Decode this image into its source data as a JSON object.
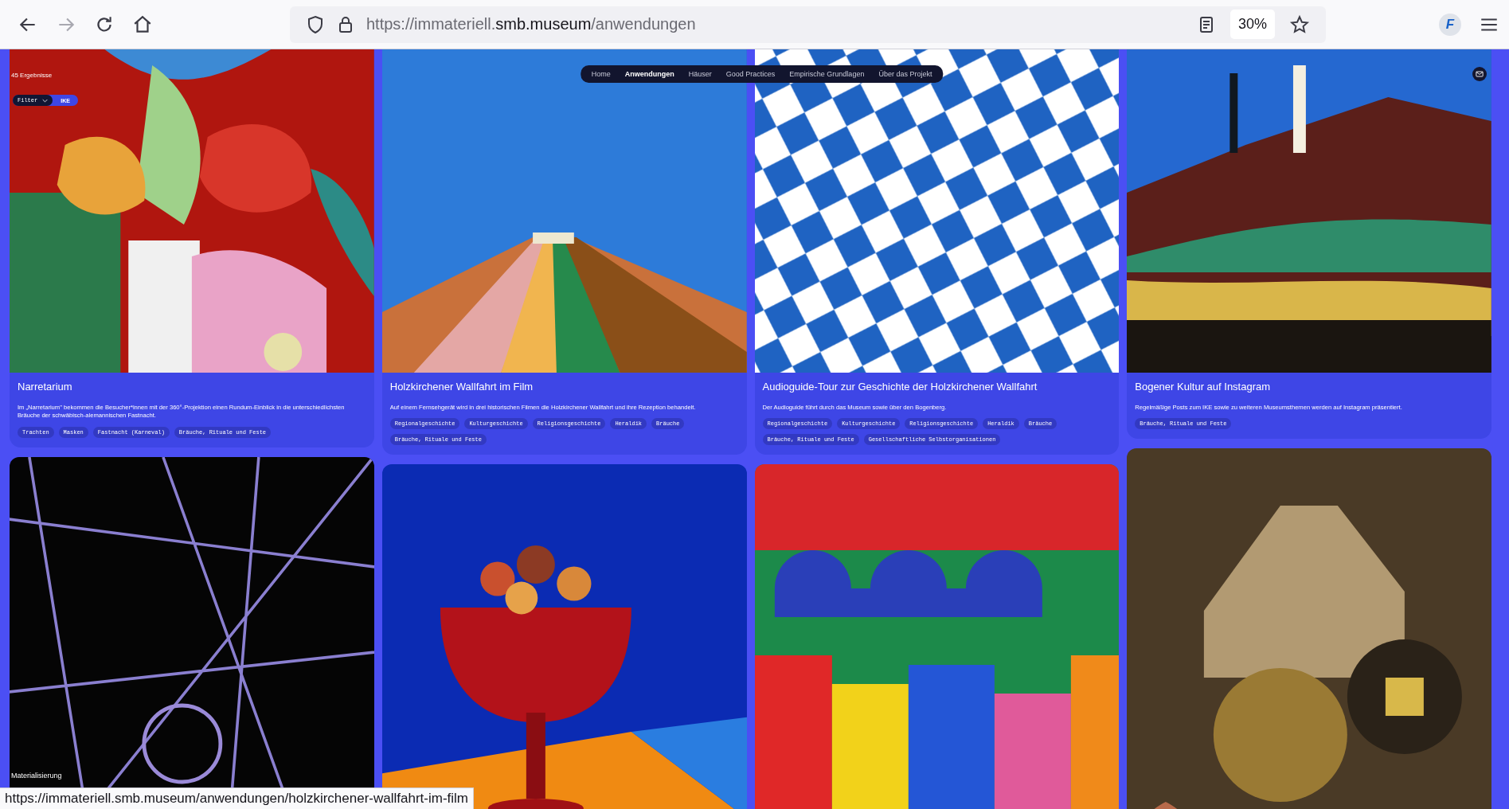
{
  "browser": {
    "back_enabled": true,
    "forward_enabled": false,
    "url_prefix": "https://immateriell.",
    "url_domain": "smb.museum",
    "url_path": "/anwendungen",
    "zoom": "30%",
    "extension_label": "F"
  },
  "nav": [
    {
      "label": "Home",
      "selected": false
    },
    {
      "label": "Anwendungen",
      "selected": true
    },
    {
      "label": "Häuser",
      "selected": false
    },
    {
      "label": "Good Practices",
      "selected": false
    },
    {
      "label": "Empirische Grundlagen",
      "selected": false
    },
    {
      "label": "Über das Projekt",
      "selected": false
    }
  ],
  "results_count": "45 Ergebnisse",
  "filter": {
    "label": "Filter",
    "active_tag": "IKE"
  },
  "cards": [
    {
      "title": "Narretarium",
      "description": "Im „Narretarium\" bekommen die Besucher*innen mit der 360°-Projektion einen Rundum-Einblick in die unterschiedlichsten Bräuche der schwäbisch-alemannischen Fastnacht.",
      "tags": [
        "Trachten",
        "Masken",
        "Fastnacht (Karneval)",
        "Bräuche, Rituale und Feste"
      ]
    },
    {
      "title": "Holzkirchener Wallfahrt im Film",
      "description": "Auf einem Fernsehgerät wird in drei historischen Filmen die Holzkirchener Wallfahrt und ihre Rezeption behandelt.",
      "tags": [
        "Regionalgeschichte",
        "Kulturgeschichte",
        "Religionsgeschichte",
        "Heraldik",
        "Bräuche",
        "Bräuche, Rituale und Feste"
      ]
    },
    {
      "title": "Audioguide-Tour zur Geschichte der Holzkirchener Wallfahrt",
      "description": "Der Audioguide führt durch das Museum sowie über den Bogenberg.",
      "tags": [
        "Regionalgeschichte",
        "Kulturgeschichte",
        "Religionsgeschichte",
        "Heraldik",
        "Bräuche",
        "Bräuche, Rituale und Feste",
        "Gesellschaftliche Selbstorganisationen"
      ]
    },
    {
      "title": "Bogener Kultur auf Instagram",
      "description": "Regelmäßige Posts zum IKE sowie zu weiteren Museumsthemen werden auf Instagram präsentiert.",
      "tags": [
        "Bräuche, Rituale und Feste"
      ]
    }
  ],
  "lower_cards": [
    {
      "kind": "picture",
      "caption": "Materialisierung"
    },
    {
      "kind": "picture"
    },
    {
      "kind": "picture"
    },
    {
      "kind": "picture"
    }
  ],
  "status_url": "https://immateriell.smb.museum/anwendungen/holzkirchener-wallfahrt-im-film"
}
